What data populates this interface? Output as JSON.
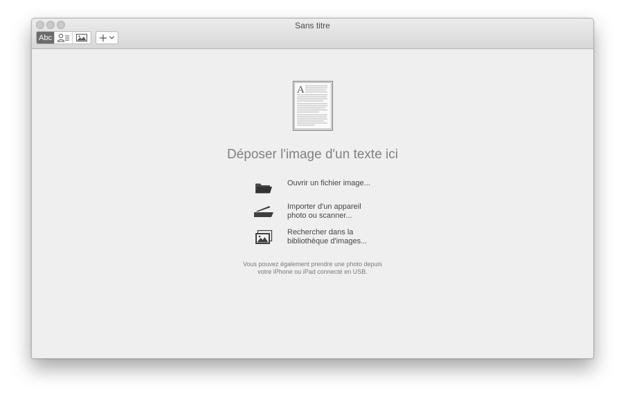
{
  "window": {
    "title": "Sans titre"
  },
  "toolbar": {
    "text_mode_label": "Abc",
    "text_mode_icon": "text-mode",
    "contact_mode_icon": "contact-card-icon",
    "image_mode_icon": "image-icon",
    "add_icon": "plus-icon",
    "add_menu_icon": "chevron-down-icon"
  },
  "main": {
    "document_icon": "text-document-icon",
    "drop_title": "Déposer l'image d'un texte ici",
    "actions": [
      {
        "icon": "folder-icon",
        "label": "Ouvrir un fichier image..."
      },
      {
        "icon": "scanner-icon",
        "label": "Importer d'un appareil\nphoto ou scanner..."
      },
      {
        "icon": "photo-library-icon",
        "label": "Rechercher dans la\nbibliothèque d'images..."
      }
    ],
    "hint": "Vous pouvez également prendre une photo depuis\nvotre iPhone ou iPad connecté en USB."
  }
}
